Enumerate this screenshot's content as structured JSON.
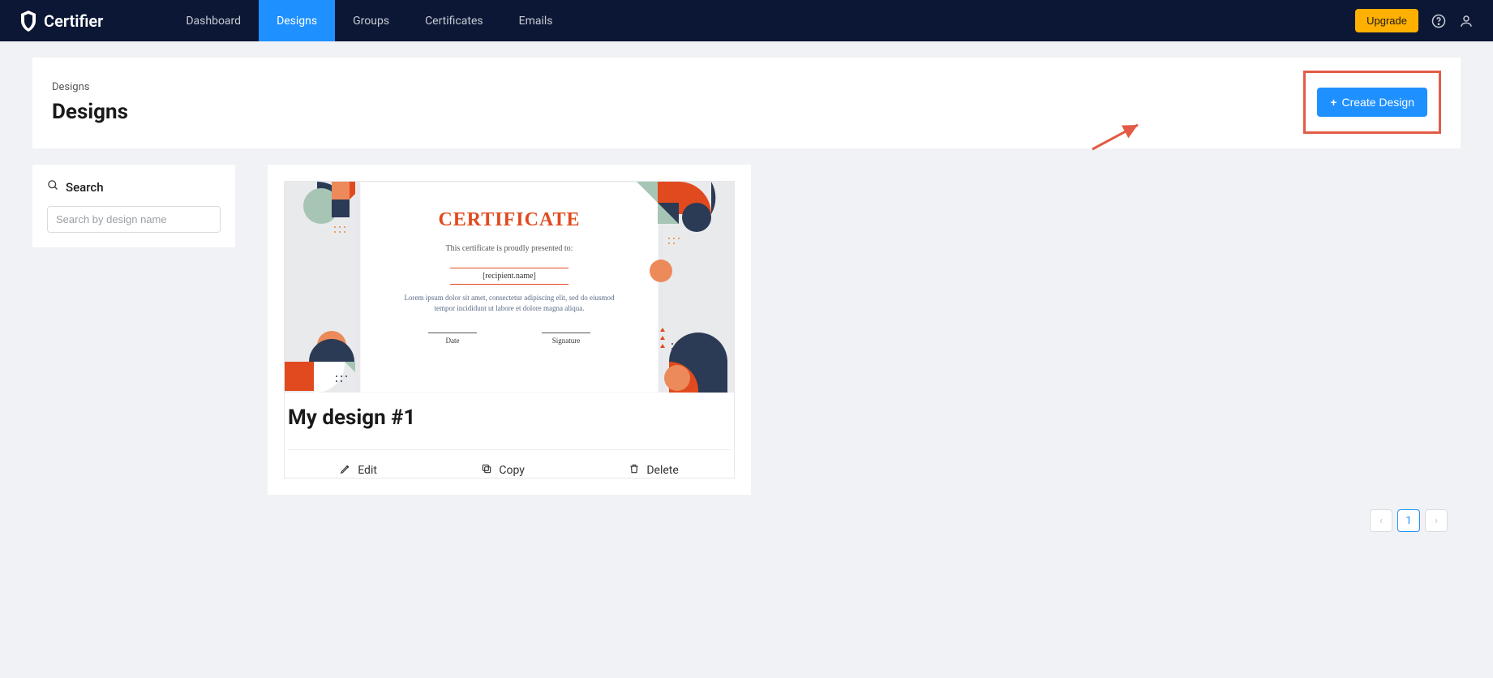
{
  "brand": "Certifier",
  "nav": {
    "dashboard": "Dashboard",
    "designs": "Designs",
    "groups": "Groups",
    "certificates": "Certificates",
    "emails": "Emails"
  },
  "upgrade_label": "Upgrade",
  "breadcrumb": "Designs",
  "page_title": "Designs",
  "create_design_label": "Create Design",
  "search": {
    "title": "Search",
    "placeholder": "Search by design name"
  },
  "design_card": {
    "name": "My design #1",
    "actions": {
      "edit": "Edit",
      "copy": "Copy",
      "delete": "Delete"
    },
    "preview": {
      "heading": "CERTIFICATE",
      "subheading": "This certificate is proudly presented to:",
      "recipient": "[recipient.name]",
      "body": "Lorem ipsum dolor sit amet, consectetur adipiscing elit, sed do eiusmod tempor incididunt ut labore et dolore magna aliqua.",
      "date_label": "Date",
      "signature_label": "Signature"
    }
  },
  "pagination": {
    "current": "1"
  }
}
